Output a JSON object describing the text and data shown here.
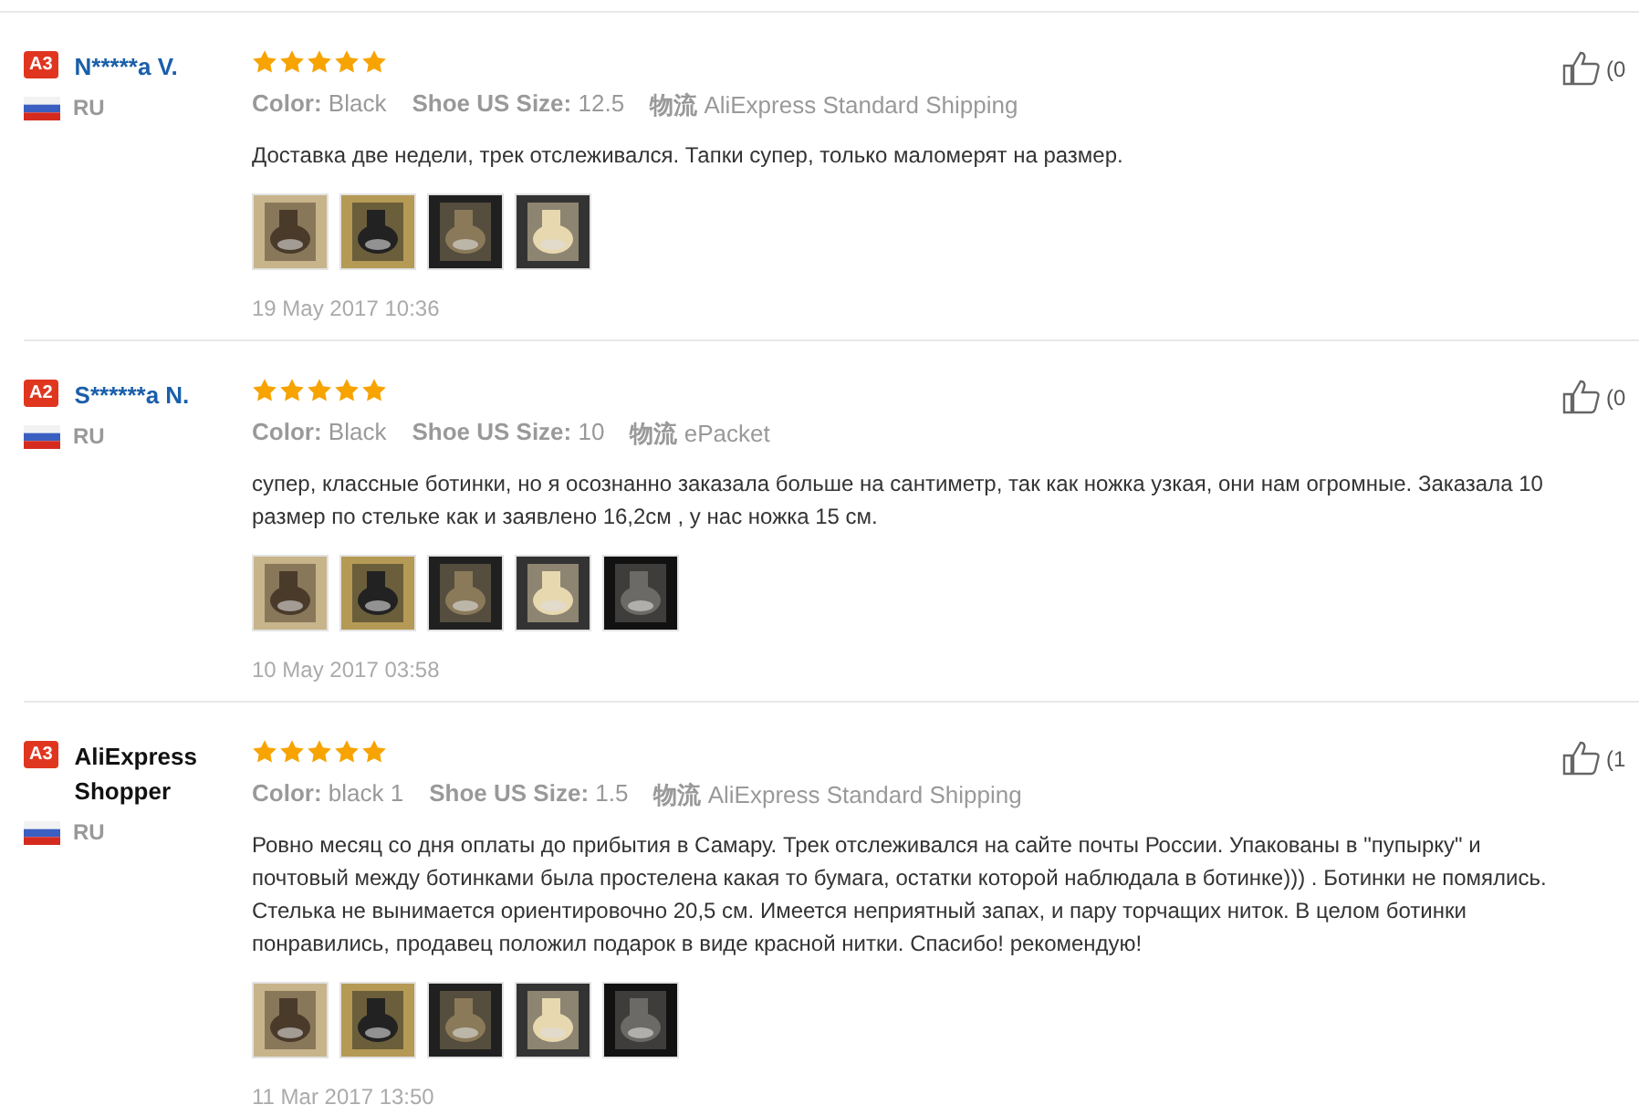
{
  "reviews": [
    {
      "level_badge": "A3",
      "name": "N*****a V.",
      "country": "RU",
      "stars": 5,
      "color_label": "Color:",
      "color_value": "Black",
      "size_label": "Shoe US Size:",
      "size": "12.5",
      "shipping_label": "物流",
      "shipping": "AliExpress Standard Shipping",
      "text": "Доставка две недели, трек отслеживался. Тапки супер, только маломерят на размер.",
      "photos": [
        {
          "kind": "picture"
        },
        {
          "kind": "picture"
        },
        {
          "kind": "picture"
        },
        {
          "kind": "picture"
        }
      ],
      "date": "19 May 2017 10:36",
      "likes": "(0"
    },
    {
      "level_badge": "A2",
      "name": "S******a N.",
      "country": "RU",
      "stars": 5,
      "color_label": "Color:",
      "color_value": "Black",
      "size_label": "Shoe US Size:",
      "size": "10",
      "shipping_label": "物流",
      "shipping": "ePacket",
      "text": "супер, классные ботинки, но я осознанно заказала больше на сантиметр, так как ножка узкая, они нам огромные. Заказала 10 размер по стельке как и заявлено 16,2см , у нас ножка 15 см.",
      "photos": [
        {
          "kind": "picture"
        },
        {
          "kind": "picture"
        },
        {
          "kind": "picture"
        },
        {
          "kind": "picture"
        },
        {
          "kind": "picture"
        }
      ],
      "date": "10 May 2017 03:58",
      "likes": "(0"
    },
    {
      "level_badge": "A3",
      "name": "AliExpress Shopper",
      "country": "RU",
      "stars": 5,
      "color_label": "Color:",
      "color_value": "black 1",
      "size_label": "Shoe US Size:",
      "size": "1.5",
      "shipping_label": "物流",
      "shipping": "AliExpress Standard Shipping",
      "text": "Ровно месяц со дня оплаты до прибытия в Самару. Трек отслеживался на сайте почты России. Упакованы в \"пупырку\" и почтовый между ботинками была простелена какая то бумага, остатки которой наблюдала в ботинке))) . Ботинки не помялись. Стелька не вынимается ориентировочно 20,5 см. Имеется неприятный запах, и пару торчащих ниток. В целом ботинки понравились, продавец положил подарок в виде красной нитки. Спасибо! рекомендую!",
      "photos": [
        {
          "kind": "picture"
        },
        {
          "kind": "picture"
        },
        {
          "kind": "picture"
        },
        {
          "kind": "picture"
        },
        {
          "kind": "picture"
        }
      ],
      "date": "11 Mar 2017 13:50",
      "likes": "(1"
    }
  ]
}
